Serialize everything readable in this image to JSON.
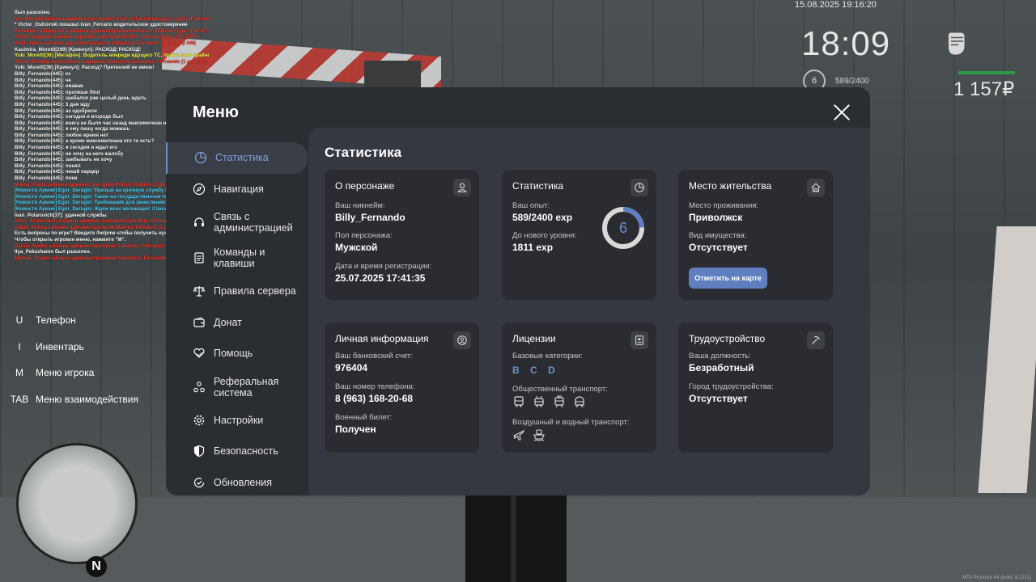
{
  "chat": [
    {
      "c": "c-w",
      "t": " был разозлен."
    },
    {
      "c": "c-r",
      "t": "Ian_Mitchell забанен администратором Geralt_Schwartzenegger (3 дн.) (Причина: pr-nacroll by GS)"
    },
    {
      "c": "c-w",
      "t": "* Victor_Ostrovski показал Ivan_Ferrario водительское удостоверение"
    },
    {
      "c": "c-r",
      "t": "Poseidon_Zalegovsky забанен администратором Robert_Dobrov (3 дн.) (Чтоб с места (21) by GS)"
    },
    {
      "c": "c-r",
      "t": "Anton_Lopezdo забанен администратором Robert_Dobrov (2 дн.) (TK (CR))"
    },
    {
      "c": "c-r",
      "t": "Kolli_Jamie забанен администратором Salvatore_Fernando (1 дн.) (by AM)"
    },
    {
      "c": "c-w",
      "t": "Kasimira_Moretti[299] [Крикнул]: РАСХОД! РАСХОД!"
    },
    {
      "c": "c-y",
      "t": "Yuki_Moretti[36] [Мегафон]: Водитель впереди идущего ТС, принимаем крайнее правое положение и останавливаемся!"
    },
    {
      "c": "c-r",
      "t": "Artem_Harutyunyan забанен администратором Salvatore_Fernando (1 дн.) (PG by AMD)"
    },
    {
      "c": "c-w",
      "t": "Yuki_Moretti[36] [Крикнул]: Расход? Претензий не имею!"
    },
    {
      "c": "c-w",
      "t": "Billy_Fernando[445]: кз"
    },
    {
      "c": "c-w",
      "t": "Billy_Fernando[445]: че"
    },
    {
      "c": "c-w",
      "t": "Billy_Fernando[445]: ивавав"
    },
    {
      "c": "c-w",
      "t": "Billy_Fernando[445]: пропиши /find"
    },
    {
      "c": "c-w",
      "t": "Billy_Fernando[445]: заебался уже целый день ждать"
    },
    {
      "c": "c-w",
      "t": "Billy_Fernando[445]: 3 дня жду"
    },
    {
      "c": "c-w",
      "t": "Billy_Fernando[445]: аз одобрили"
    },
    {
      "c": "c-w",
      "t": "Billy_Fernando[445]: сегодня и вгороде был"
    },
    {
      "c": "c-w",
      "t": "Billy_Fernando[445]: внега не было час назад максимилиан написал"
    },
    {
      "c": "c-w",
      "t": "Billy_Fernando[445]: я ему пишу когда можешь"
    },
    {
      "c": "c-w",
      "t": "Billy_Fernando[445]: любое время нет"
    },
    {
      "c": "c-w",
      "t": "Billy_Fernando[445]: а кроме максимилиана кто то есть?"
    },
    {
      "c": "c-w",
      "t": "Billy_Fernando[445]: я сегодня и ждал его"
    },
    {
      "c": "c-w",
      "t": "Billy_Fernando[445]: не хочу на него жалобу"
    },
    {
      "c": "c-w",
      "t": "Billy_Fernando[445]: заебывать не хочу"
    },
    {
      "c": "c-w",
      "t": "Billy_Fernando[445]: понял"
    },
    {
      "c": "c-w",
      "t": "Billy_Fernando[445]: чекай парцир"
    },
    {
      "c": "c-w",
      "t": "Billy_Fernando[445]: поки"
    },
    {
      "c": "c-r",
      "t": "Nikola_Popic забанен администратором Robert_Dobrov (3 дн.) (PG by RDD)"
    },
    {
      "c": "c-c",
      "t": "[Новости Армии] Egor_Derugin: Призыв на срочную службу в вооруженные силы республики Провинции окончен!"
    },
    {
      "c": "c-c",
      "t": "[Новости Армии] Egor_Derugin: Также на государственном портале открыто заявление на контрактную службу."
    },
    {
      "c": "c-c",
      "t": "[Новости Армии] Egor_Derugin: Требования для зачисления: 5 лет прописки, хорошее состояние здоровья, военный билет."
    },
    {
      "c": "c-c",
      "t": "[Новости Армии] Egor_Derugin: Ждем всех желающих! Спасибо за внимание!"
    },
    {
      "c": "c-w",
      "t": "Ivan_Polarovich[37]: удачной службы"
    },
    {
      "c": "c-r",
      "t": "Artur_Teslev был забанен администратором Salvatore_Fernando (1 час.) (Вход в нс)"
    },
    {
      "c": "c-r",
      "t": "Adam_Pomra забанен администратором Matvey_Fetrakov (3 дн.) (Жалоба на /id &id by ARM accept)"
    },
    {
      "c": "c-w",
      "t": "Есть вопросы по игре? Введите /helpme чтобы получить нужную информацию!"
    },
    {
      "c": "c-w",
      "t": "Чтобы открыть игровое меню, нажмите \"M\"."
    },
    {
      "c": "c-r",
      "t": "Danila_Nokky забанен администратором Salvatore_Fernando (Читы by AMD)"
    },
    {
      "c": "c-w",
      "t": "Ilya_Pekuzhanin был разозлен."
    },
    {
      "c": "c-r",
      "t": "Mikhail_Graph забанен администратором Salvatore_Fernando (30 дн.) (Осквернение by AMD)"
    }
  ],
  "hud": {
    "date": "15.08.2025 19:16:20",
    "time": "18:09",
    "level": "6",
    "exp": "589/2400",
    "money": "1 157₽"
  },
  "hotkeys": [
    {
      "key": "U",
      "label": "Телефон"
    },
    {
      "key": "I",
      "label": "Инвентарь"
    },
    {
      "key": "M",
      "label": "Меню игрока"
    },
    {
      "key": "TAB",
      "label": "Меню взаимодействия"
    }
  ],
  "menu": {
    "title": "Меню",
    "nav": [
      {
        "label": "Статистика",
        "icon": "pie-chart-icon",
        "active": true
      },
      {
        "label": "Навигация",
        "icon": "compass-icon"
      },
      {
        "label": "Связь с администрацией",
        "icon": "headset-icon"
      },
      {
        "label": "Команды и клавиши",
        "icon": "document-icon"
      },
      {
        "label": "Правила сервера",
        "icon": "scales-icon"
      },
      {
        "label": "Донат",
        "icon": "wallet-icon"
      },
      {
        "label": "Помощь",
        "icon": "heart-hand-icon"
      },
      {
        "label": "Реферальная система",
        "icon": "people-network-icon"
      },
      {
        "label": "Настройки",
        "icon": "gear-icon"
      },
      {
        "label": "Безопасность",
        "icon": "shield-icon"
      },
      {
        "label": "Обновления",
        "icon": "refresh-check-icon"
      }
    ]
  },
  "stats": {
    "title": "Статистика",
    "persona": {
      "title": "О персонаже",
      "nick_label": "Ваш никнейм:",
      "nick": "Billy_Fernando",
      "gender_label": "Пол персонажа:",
      "gender": "Мужской",
      "reg_label": "Дата и время регистрации:",
      "reg": "25.07.2025 17:41:35"
    },
    "statistics": {
      "title": "Статистика",
      "exp_label": "Ваш опыт:",
      "exp": "589/2400 exp",
      "next_label": "До нового уровня:",
      "next": "1811 exp",
      "level": "6",
      "progress": 0.245
    },
    "residence": {
      "title": "Место жительства",
      "place_label": "Место проживания:",
      "place": "Приволжск",
      "property_label": "Вид имущества:",
      "property": "Отсутствует",
      "button": "Отметить на карте"
    },
    "personal": {
      "title": "Личная информация",
      "bank_label": "Ваш банковский счет:",
      "bank": "976404",
      "phone_label": "Ваш номер телефона:",
      "phone": "8 (963) 168-20-68",
      "military_label": "Военный билет:",
      "military": "Получен"
    },
    "licenses": {
      "title": "Лицензии",
      "base_label": "Базовые категории:",
      "base": "B C D",
      "public_label": "Общественный транспорт:",
      "air_label": "Воздушный и водный транспорт:"
    },
    "employment": {
      "title": "Трудоустройство",
      "position_label": "Ваша должность:",
      "position": "Безработный",
      "city_label": "Город трудоустройства:",
      "city": "Отсутствует"
    }
  },
  "watermark": "MTA Province #4 (build: 6.1211)"
}
